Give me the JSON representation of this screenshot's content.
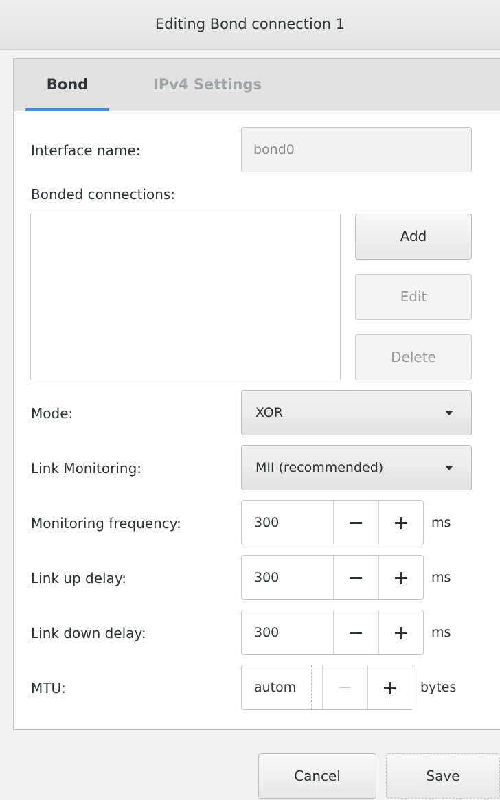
{
  "window": {
    "title": "Editing Bond connection 1"
  },
  "tabs": [
    {
      "label": "Bond",
      "active": true
    },
    {
      "label": "IPv4 Settings",
      "active": false
    }
  ],
  "bond": {
    "interface_name_label": "Interface name:",
    "interface_name_value": "bond0",
    "bonded_connections_label": "Bonded connections:",
    "bonded_connections": [],
    "buttons": {
      "add": "Add",
      "edit": "Edit",
      "delete": "Delete"
    },
    "mode_label": "Mode:",
    "mode_value": "XOR",
    "link_monitoring_label": "Link Monitoring:",
    "link_monitoring_value": "MII (recommended)",
    "monitoring_frequency_label": "Monitoring frequency:",
    "monitoring_frequency_value": "300",
    "monitoring_frequency_unit": "ms",
    "link_up_delay_label": "Link up delay:",
    "link_up_delay_value": "300",
    "link_up_delay_unit": "ms",
    "link_down_delay_label": "Link down delay:",
    "link_down_delay_value": "300",
    "link_down_delay_unit": "ms",
    "mtu_label": "MTU:",
    "mtu_value": "autom",
    "mtu_unit": "bytes"
  },
  "footer": {
    "cancel_label": "Cancel",
    "save_label": "Save"
  },
  "colors": {
    "accent": "#4a90d9",
    "window_bg": "#f2f2f2",
    "text": "#2e3436",
    "disabled_text": "#969a9b"
  }
}
